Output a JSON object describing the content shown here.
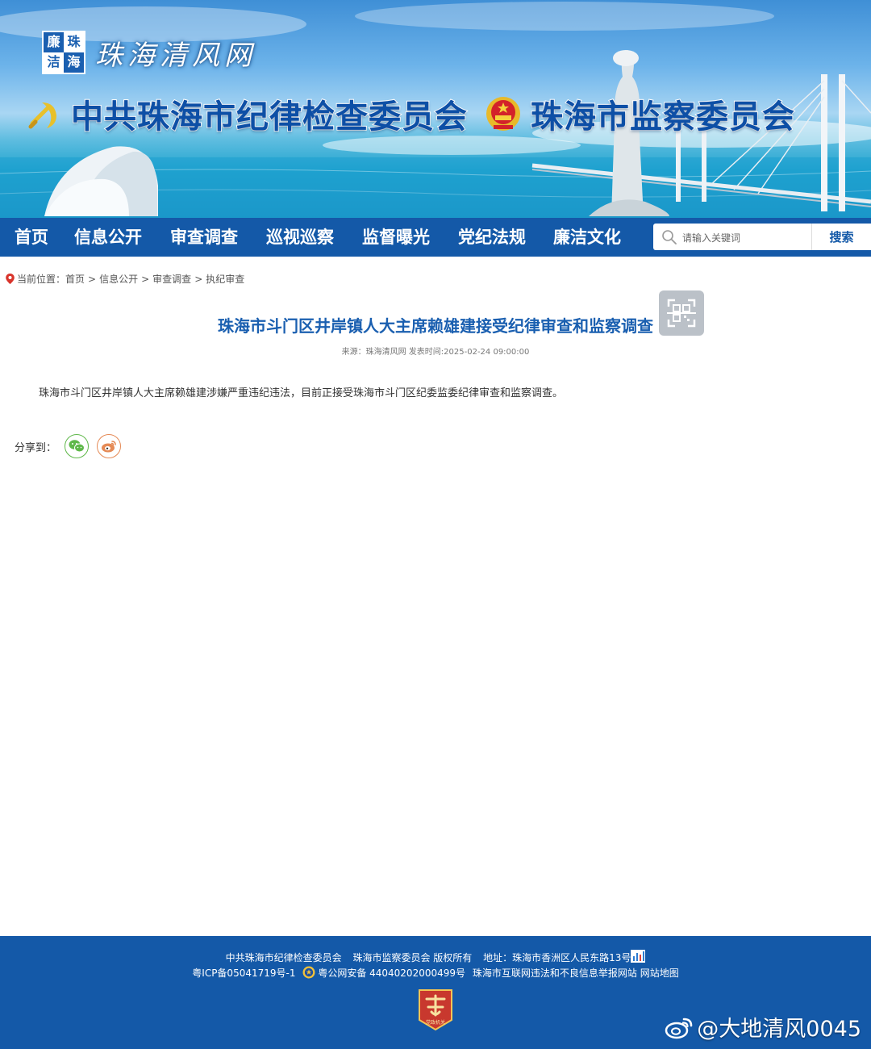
{
  "banner": {
    "logo_badge": [
      "廉",
      "珠",
      "洁",
      "海"
    ],
    "site_name": "珠海清风网",
    "org_left": "中共珠海市纪律检查委员会",
    "org_right": "珠海市监察委员会"
  },
  "nav": {
    "items": [
      "首页",
      "信息公开",
      "审查调查",
      "巡视巡察",
      "监督曝光",
      "党纪法规",
      "廉洁文化"
    ]
  },
  "search": {
    "placeholder": "请输入关键词",
    "button": "搜索"
  },
  "breadcrumb": {
    "label": "当前位置：",
    "items": [
      "首页",
      "信息公开",
      "审查调查",
      "执纪审查"
    ],
    "separator": ">"
  },
  "article": {
    "title": "珠海市斗门区井岸镇人大主席赖雄建接受纪律审查和监察调查",
    "meta": "来源：珠海清风网 发表时间:2025-02-24 09:00:00",
    "body": "珠海市斗门区井岸镇人大主席赖雄建涉嫌严重违纪违法，目前正接受珠海市斗门区纪委监委纪律审查和监察调查。"
  },
  "share": {
    "label": "分享到："
  },
  "footer": {
    "org1": "中共珠海市纪律检查委员会",
    "org2": "珠海市监察委员会 版权所有",
    "address": "地址：珠海市香洲区人民东路13号",
    "icp": "粤ICP备05041719号-1",
    "police": "粤公网安备 44040202000499号",
    "report_site": "珠海市互联网违法和不良信息举报网站",
    "sitemap": "网站地图",
    "badge_text": "党政机关"
  },
  "watermark": {
    "text": "@大地清风0045"
  },
  "colors": {
    "brand_blue": "#1459a8",
    "title_blue": "#1a5fb0",
    "wechat_green": "#5fb84a",
    "weibo_orange": "#e58a56"
  }
}
